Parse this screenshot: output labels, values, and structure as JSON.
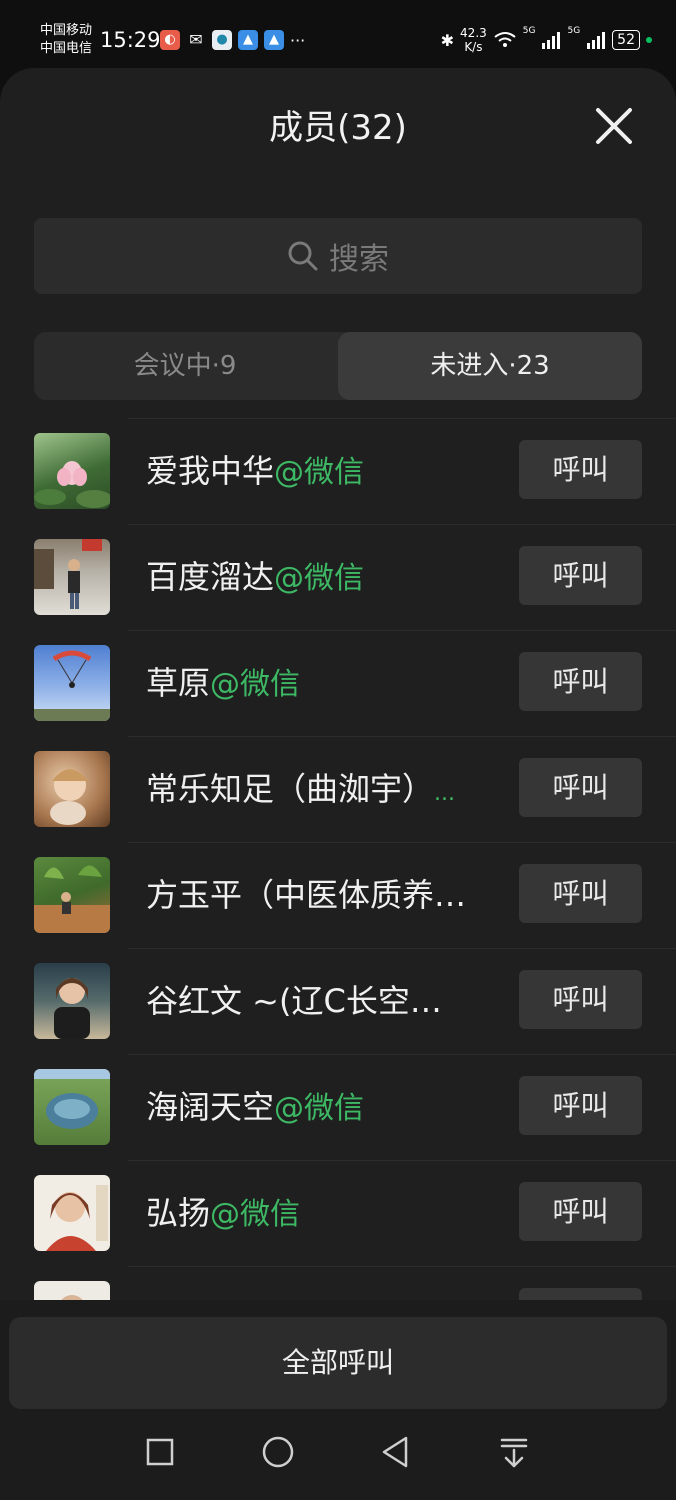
{
  "status_bar": {
    "carrier1": "中国移动",
    "carrier2": "中国电信",
    "time": "15:29",
    "net_speed_value": "42.3",
    "net_speed_unit": "K/s",
    "signal_label_1": "5G",
    "signal_label_2": "5G",
    "battery": "52",
    "more": "···"
  },
  "header": {
    "title": "成员(32)"
  },
  "search": {
    "placeholder": "搜索"
  },
  "tabs": [
    {
      "label": "会议中·9",
      "active": false
    },
    {
      "label": "未进入·23",
      "active": true
    }
  ],
  "members": [
    {
      "name": "爱我中华",
      "suffix": "@微信",
      "call_label": "呼叫"
    },
    {
      "name": "百度溜达",
      "suffix": "@微信",
      "call_label": "呼叫"
    },
    {
      "name": "草原",
      "suffix": "@微信",
      "call_label": "呼叫"
    },
    {
      "name": "常乐知足（曲洳宇）",
      "suffix": "...",
      "call_label": "呼叫"
    },
    {
      "name": "方玉平（中医体质养…",
      "suffix": "",
      "call_label": "呼叫"
    },
    {
      "name": "谷红文 ~(辽C长空…",
      "suffix": "",
      "call_label": "呼叫"
    },
    {
      "name": "海阔天空",
      "suffix": "@微信",
      "call_label": "呼叫"
    },
    {
      "name": "弘扬",
      "suffix": "@微信",
      "call_label": "呼叫"
    },
    {
      "name": "",
      "suffix": "",
      "call_label": ""
    }
  ],
  "footer": {
    "call_all_label": "全部呼叫"
  },
  "colors": {
    "background": "#1f1f1f",
    "accent_green": "#3db864",
    "button_bg": "#363636"
  },
  "icons": [
    "search-icon",
    "close-icon",
    "nav-square-icon",
    "nav-circle-icon",
    "nav-back-icon",
    "nav-menu-icon"
  ]
}
